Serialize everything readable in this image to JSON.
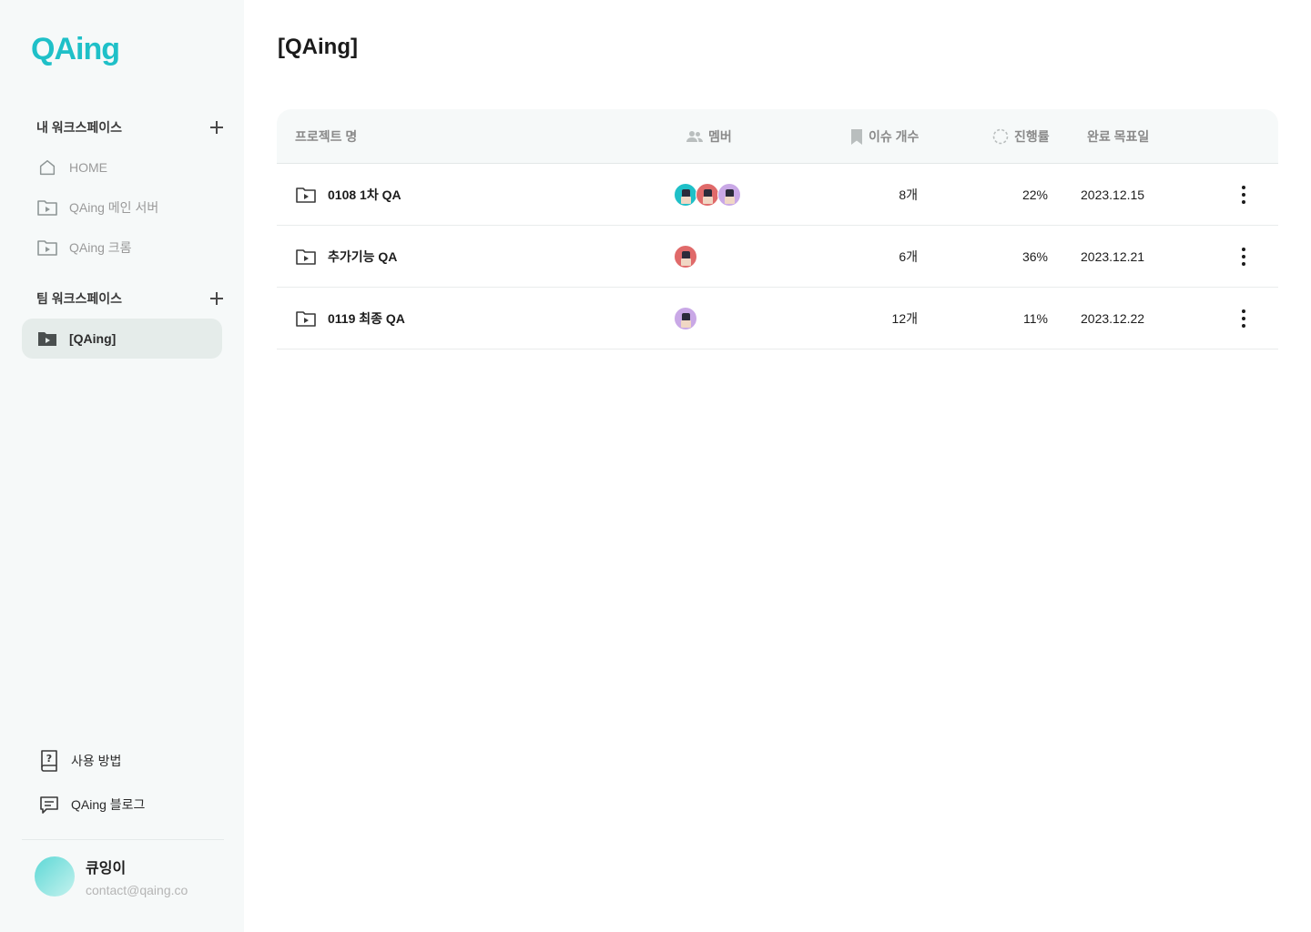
{
  "sidebar": {
    "logo": "QAing",
    "my_workspace": {
      "title": "내 워크스페이스",
      "items": [
        {
          "label": "HOME",
          "icon": "home-icon"
        },
        {
          "label": "QAing 메인 서버",
          "icon": "folder-play-icon"
        },
        {
          "label": "QAing 크롬",
          "icon": "folder-play-icon"
        }
      ]
    },
    "team_workspace": {
      "title": "팀 워크스페이스",
      "items": [
        {
          "label": "[QAing]",
          "icon": "folder-play-filled-icon",
          "active": true
        }
      ]
    },
    "footer": {
      "guide_label": "사용 방법",
      "blog_label": "QAing 블로그"
    },
    "profile": {
      "name": "큐잉이",
      "email": "contact@qaing.co"
    }
  },
  "main": {
    "title": "[QAing]",
    "columns": {
      "name": "프로젝트 명",
      "members": "멤버",
      "issues": "이슈 개수",
      "progress": "진행률",
      "due": "완료 목표일"
    },
    "rows": [
      {
        "name": "0108 1차 QA",
        "members": [
          "#1fc0c8",
          "#e06a6a",
          "#c9a8e6"
        ],
        "issues": "8개",
        "progress": "22%",
        "due": "2023.12.15"
      },
      {
        "name": "추가기능 QA",
        "members": [
          "#e06a6a"
        ],
        "issues": "6개",
        "progress": "36%",
        "due": "2023.12.21"
      },
      {
        "name": "0119 최종 QA",
        "members": [
          "#c9a8e6"
        ],
        "issues": "12개",
        "progress": "11%",
        "due": "2023.12.22"
      }
    ]
  },
  "colors": {
    "brand": "#1fc0c8",
    "sidebar_bg": "#f6f9f9",
    "active_item_bg": "#e5ecea"
  }
}
